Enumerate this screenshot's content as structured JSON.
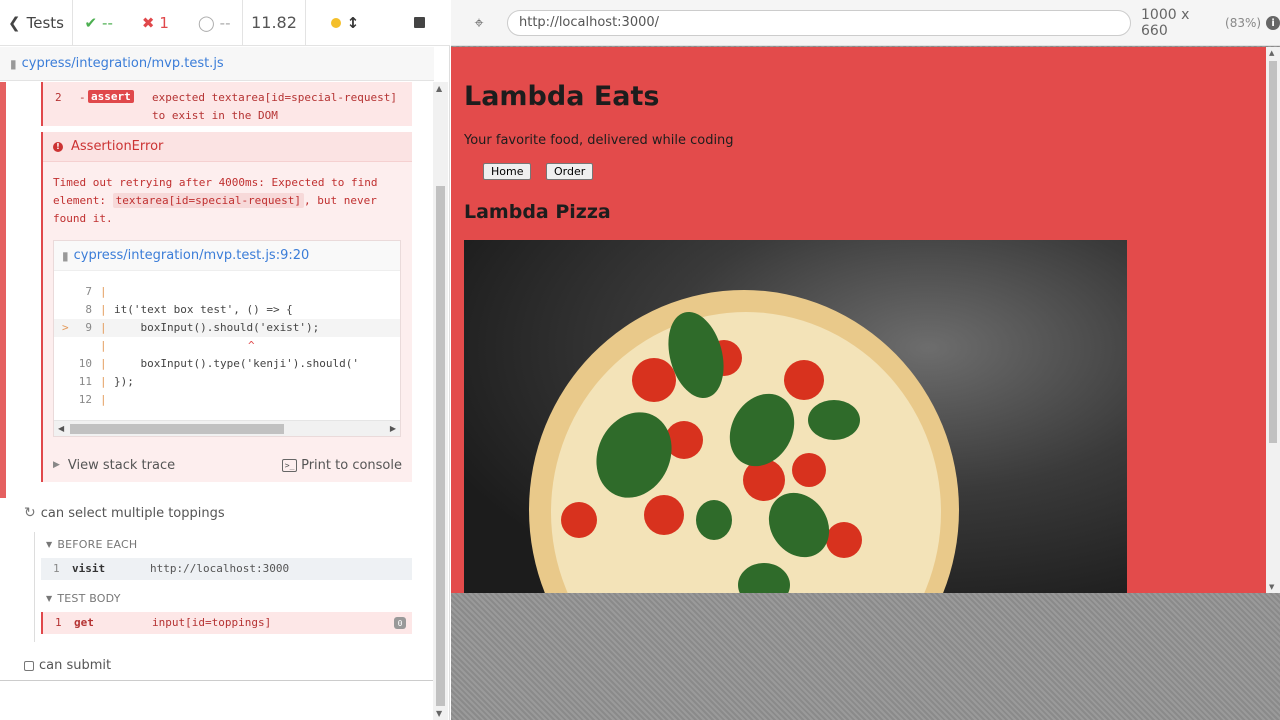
{
  "topbar": {
    "tests_label": "Tests",
    "passed": "--",
    "failed": "1",
    "pending": "--",
    "duration": "11.82"
  },
  "spec": {
    "path": "cypress/integration/mvp.test.js"
  },
  "failed_command": {
    "num": "2",
    "name": "assert",
    "message_line1": "expected textarea[id=special-request]",
    "message_line2": "to exist in the DOM"
  },
  "error": {
    "title": "AssertionError",
    "msg_line1": "Timed out retrying after 4000ms: Expected to find",
    "msg_line2_pre": "element: ",
    "msg_line2_code": "textarea[id=special-request]",
    "msg_line2_post": ", but never",
    "msg_line3": "found it.",
    "file_link": "cypress/integration/mvp.test.js:9:20",
    "code_lines": [
      {
        "num": "7",
        "code": ""
      },
      {
        "num": "8",
        "code": "it('text box test', () => {"
      },
      {
        "num": "9",
        "code": "    boxInput().should('exist');"
      },
      {
        "num": "",
        "code": ""
      },
      {
        "num": "10",
        "code": "    boxInput().type('kenji').should('"
      },
      {
        "num": "11",
        "code": "});"
      },
      {
        "num": "12",
        "code": ""
      }
    ],
    "caret": "^",
    "arrow": ">",
    "view_stack": "View stack trace",
    "print_console": "Print to console"
  },
  "test2": {
    "title": "can select multiple toppings",
    "before_each": "BEFORE EACH",
    "visit_num": "1",
    "visit_name": "visit",
    "visit_url": "http://localhost:3000",
    "test_body": "TEST BODY",
    "get_num": "1",
    "get_name": "get",
    "get_selector": "input[id=toppings]",
    "get_badge": "0"
  },
  "test3": {
    "title": "can submit"
  },
  "browser": {
    "url": "http://localhost:3000/",
    "viewport": "1000 x 660",
    "scale": "(83%)"
  },
  "app": {
    "title": "Lambda Eats",
    "tagline": "Your favorite food, delivered while coding",
    "nav_home": "Home",
    "nav_order": "Order",
    "section_title": "Lambda Pizza"
  },
  "colors": {
    "fail": "#e0484b",
    "pass": "#4caf50",
    "app_bg": "#e34b4b",
    "link": "#3b7dd8"
  }
}
